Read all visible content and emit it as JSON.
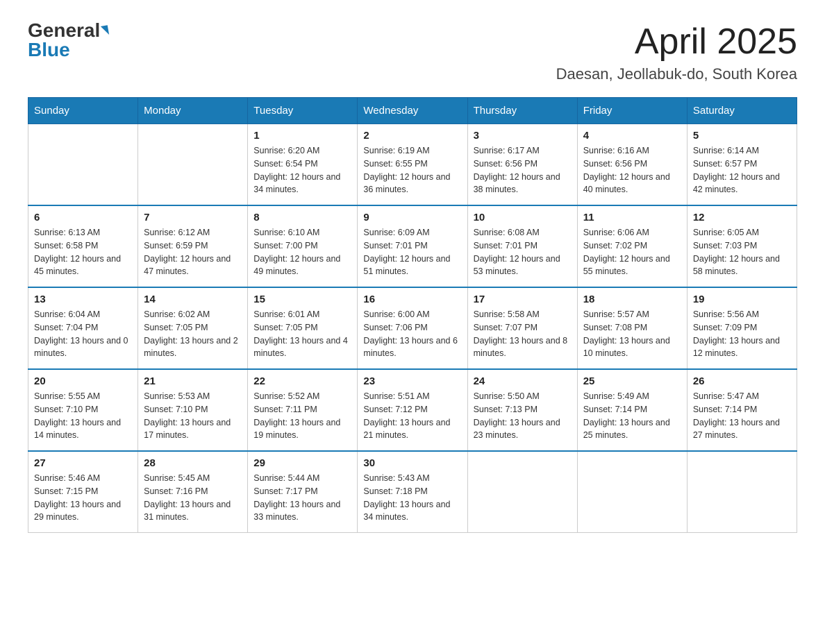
{
  "header": {
    "logo_general": "General",
    "logo_blue": "Blue",
    "title": "April 2025",
    "location": "Daesan, Jeollabuk-do, South Korea"
  },
  "weekdays": [
    "Sunday",
    "Monday",
    "Tuesday",
    "Wednesday",
    "Thursday",
    "Friday",
    "Saturday"
  ],
  "weeks": [
    [
      {
        "day": "",
        "sunrise": "",
        "sunset": "",
        "daylight": ""
      },
      {
        "day": "",
        "sunrise": "",
        "sunset": "",
        "daylight": ""
      },
      {
        "day": "1",
        "sunrise": "Sunrise: 6:20 AM",
        "sunset": "Sunset: 6:54 PM",
        "daylight": "Daylight: 12 hours and 34 minutes."
      },
      {
        "day": "2",
        "sunrise": "Sunrise: 6:19 AM",
        "sunset": "Sunset: 6:55 PM",
        "daylight": "Daylight: 12 hours and 36 minutes."
      },
      {
        "day": "3",
        "sunrise": "Sunrise: 6:17 AM",
        "sunset": "Sunset: 6:56 PM",
        "daylight": "Daylight: 12 hours and 38 minutes."
      },
      {
        "day": "4",
        "sunrise": "Sunrise: 6:16 AM",
        "sunset": "Sunset: 6:56 PM",
        "daylight": "Daylight: 12 hours and 40 minutes."
      },
      {
        "day": "5",
        "sunrise": "Sunrise: 6:14 AM",
        "sunset": "Sunset: 6:57 PM",
        "daylight": "Daylight: 12 hours and 42 minutes."
      }
    ],
    [
      {
        "day": "6",
        "sunrise": "Sunrise: 6:13 AM",
        "sunset": "Sunset: 6:58 PM",
        "daylight": "Daylight: 12 hours and 45 minutes."
      },
      {
        "day": "7",
        "sunrise": "Sunrise: 6:12 AM",
        "sunset": "Sunset: 6:59 PM",
        "daylight": "Daylight: 12 hours and 47 minutes."
      },
      {
        "day": "8",
        "sunrise": "Sunrise: 6:10 AM",
        "sunset": "Sunset: 7:00 PM",
        "daylight": "Daylight: 12 hours and 49 minutes."
      },
      {
        "day": "9",
        "sunrise": "Sunrise: 6:09 AM",
        "sunset": "Sunset: 7:01 PM",
        "daylight": "Daylight: 12 hours and 51 minutes."
      },
      {
        "day": "10",
        "sunrise": "Sunrise: 6:08 AM",
        "sunset": "Sunset: 7:01 PM",
        "daylight": "Daylight: 12 hours and 53 minutes."
      },
      {
        "day": "11",
        "sunrise": "Sunrise: 6:06 AM",
        "sunset": "Sunset: 7:02 PM",
        "daylight": "Daylight: 12 hours and 55 minutes."
      },
      {
        "day": "12",
        "sunrise": "Sunrise: 6:05 AM",
        "sunset": "Sunset: 7:03 PM",
        "daylight": "Daylight: 12 hours and 58 minutes."
      }
    ],
    [
      {
        "day": "13",
        "sunrise": "Sunrise: 6:04 AM",
        "sunset": "Sunset: 7:04 PM",
        "daylight": "Daylight: 13 hours and 0 minutes."
      },
      {
        "day": "14",
        "sunrise": "Sunrise: 6:02 AM",
        "sunset": "Sunset: 7:05 PM",
        "daylight": "Daylight: 13 hours and 2 minutes."
      },
      {
        "day": "15",
        "sunrise": "Sunrise: 6:01 AM",
        "sunset": "Sunset: 7:05 PM",
        "daylight": "Daylight: 13 hours and 4 minutes."
      },
      {
        "day": "16",
        "sunrise": "Sunrise: 6:00 AM",
        "sunset": "Sunset: 7:06 PM",
        "daylight": "Daylight: 13 hours and 6 minutes."
      },
      {
        "day": "17",
        "sunrise": "Sunrise: 5:58 AM",
        "sunset": "Sunset: 7:07 PM",
        "daylight": "Daylight: 13 hours and 8 minutes."
      },
      {
        "day": "18",
        "sunrise": "Sunrise: 5:57 AM",
        "sunset": "Sunset: 7:08 PM",
        "daylight": "Daylight: 13 hours and 10 minutes."
      },
      {
        "day": "19",
        "sunrise": "Sunrise: 5:56 AM",
        "sunset": "Sunset: 7:09 PM",
        "daylight": "Daylight: 13 hours and 12 minutes."
      }
    ],
    [
      {
        "day": "20",
        "sunrise": "Sunrise: 5:55 AM",
        "sunset": "Sunset: 7:10 PM",
        "daylight": "Daylight: 13 hours and 14 minutes."
      },
      {
        "day": "21",
        "sunrise": "Sunrise: 5:53 AM",
        "sunset": "Sunset: 7:10 PM",
        "daylight": "Daylight: 13 hours and 17 minutes."
      },
      {
        "day": "22",
        "sunrise": "Sunrise: 5:52 AM",
        "sunset": "Sunset: 7:11 PM",
        "daylight": "Daylight: 13 hours and 19 minutes."
      },
      {
        "day": "23",
        "sunrise": "Sunrise: 5:51 AM",
        "sunset": "Sunset: 7:12 PM",
        "daylight": "Daylight: 13 hours and 21 minutes."
      },
      {
        "day": "24",
        "sunrise": "Sunrise: 5:50 AM",
        "sunset": "Sunset: 7:13 PM",
        "daylight": "Daylight: 13 hours and 23 minutes."
      },
      {
        "day": "25",
        "sunrise": "Sunrise: 5:49 AM",
        "sunset": "Sunset: 7:14 PM",
        "daylight": "Daylight: 13 hours and 25 minutes."
      },
      {
        "day": "26",
        "sunrise": "Sunrise: 5:47 AM",
        "sunset": "Sunset: 7:14 PM",
        "daylight": "Daylight: 13 hours and 27 minutes."
      }
    ],
    [
      {
        "day": "27",
        "sunrise": "Sunrise: 5:46 AM",
        "sunset": "Sunset: 7:15 PM",
        "daylight": "Daylight: 13 hours and 29 minutes."
      },
      {
        "day": "28",
        "sunrise": "Sunrise: 5:45 AM",
        "sunset": "Sunset: 7:16 PM",
        "daylight": "Daylight: 13 hours and 31 minutes."
      },
      {
        "day": "29",
        "sunrise": "Sunrise: 5:44 AM",
        "sunset": "Sunset: 7:17 PM",
        "daylight": "Daylight: 13 hours and 33 minutes."
      },
      {
        "day": "30",
        "sunrise": "Sunrise: 5:43 AM",
        "sunset": "Sunset: 7:18 PM",
        "daylight": "Daylight: 13 hours and 34 minutes."
      },
      {
        "day": "",
        "sunrise": "",
        "sunset": "",
        "daylight": ""
      },
      {
        "day": "",
        "sunrise": "",
        "sunset": "",
        "daylight": ""
      },
      {
        "day": "",
        "sunrise": "",
        "sunset": "",
        "daylight": ""
      }
    ]
  ]
}
